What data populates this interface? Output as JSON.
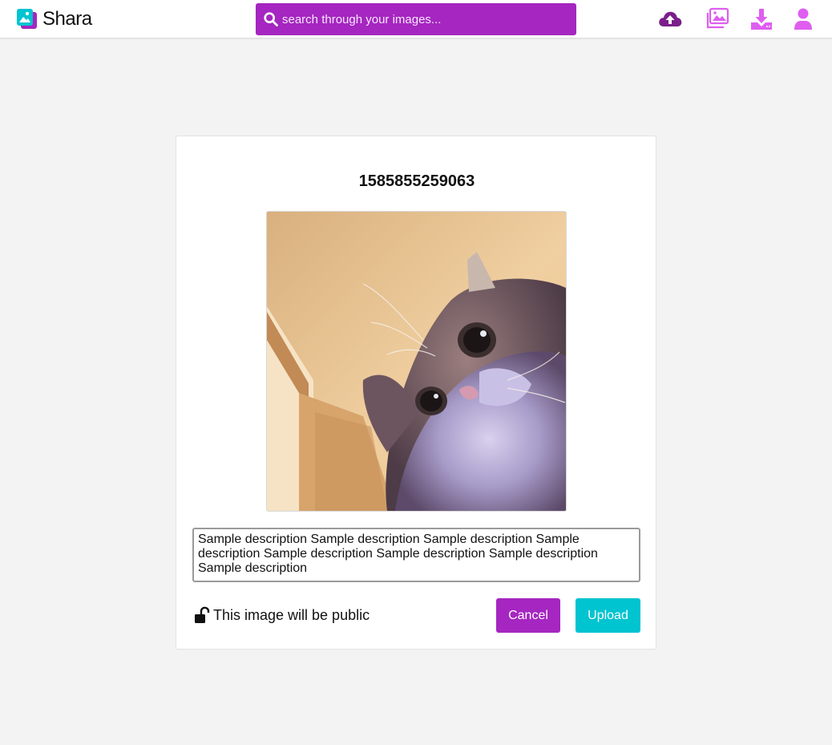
{
  "colors": {
    "brand_purple": "#a526c0",
    "dark_purple": "#7a1f8a",
    "light_purple": "#df5ef0",
    "brand_teal": "#00c4d0",
    "background": "#f3f3f3"
  },
  "navbar": {
    "logo_text": "Shara",
    "search": {
      "placeholder": "search through your images...",
      "value": ""
    },
    "icons": [
      "upload-cloud-icon",
      "gallery-icon",
      "download-icon",
      "user-icon"
    ]
  },
  "upload_card": {
    "title": "1585855259063",
    "image_alt": "cat",
    "description": "Sample description Sample description Sample description Sample description Sample description Sample description Sample description Sample description",
    "visibility_label": "This image will be public",
    "visibility_icon": "unlock-icon",
    "cancel_label": "Cancel",
    "upload_label": "Upload"
  }
}
